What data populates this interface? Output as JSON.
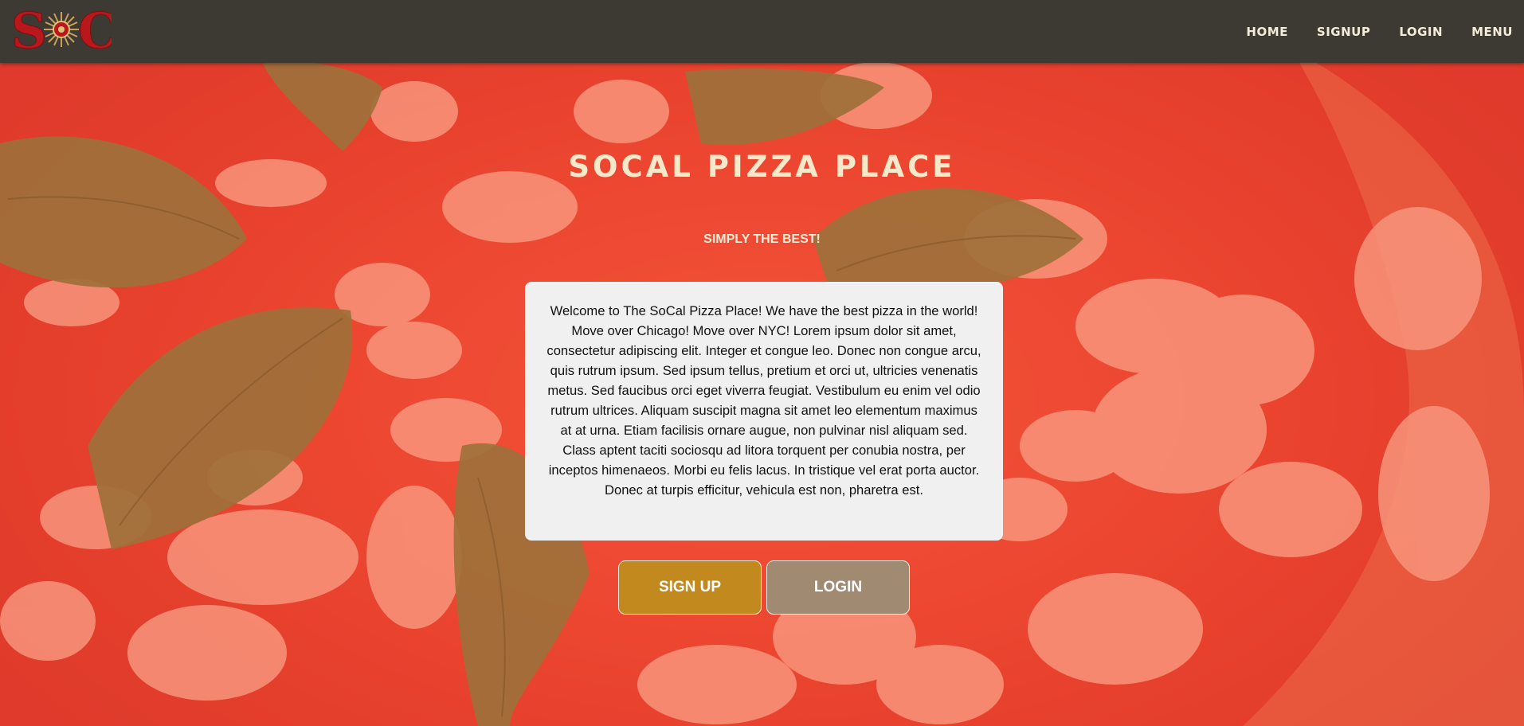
{
  "nav": {
    "logo_text": "SC",
    "links": [
      {
        "label": "HOME"
      },
      {
        "label": "SIGNUP"
      },
      {
        "label": "LOGIN"
      },
      {
        "label": "MENU"
      }
    ]
  },
  "hero": {
    "title": "SOCAL PIZZA PLACE",
    "subtitle": "SIMPLY THE BEST!",
    "body": "Welcome to The SoCal Pizza Place! We have the best pizza in the world! Move over Chicago! Move over NYC! Lorem ipsum dolor sit amet, consectetur adipiscing elit. Integer et congue leo. Donec non congue arcu, quis rutrum ipsum. Sed ipsum tellus, pretium et orci ut, ultricies venenatis metus. Sed faucibus orci eget viverra feugiat. Vestibulum eu enim vel odio rutrum ultrices. Aliquam suscipit magna sit amet leo elementum maximus at at urna. Etiam facilisis ornare augue, non pulvinar nisl aliquam sed. Class aptent taciti sociosqu ad litora torquent per conubia nostra, per inceptos himenaeos. Morbi eu felis lacus. In tristique vel erat porta auctor. Donec at turpis efficitur, vehicula est non, pharetra est.",
    "signup_label": "SIGN UP",
    "login_label": "LOGIN"
  },
  "colors": {
    "nav_bg": "#3d3a34",
    "nav_text": "#f3ecd8",
    "title": "#f5e9c9",
    "signup_button": "#c28a1e",
    "login_button": "#a08a72",
    "card_bg": "#f0f0f0",
    "logo_red": "#b8181c"
  }
}
